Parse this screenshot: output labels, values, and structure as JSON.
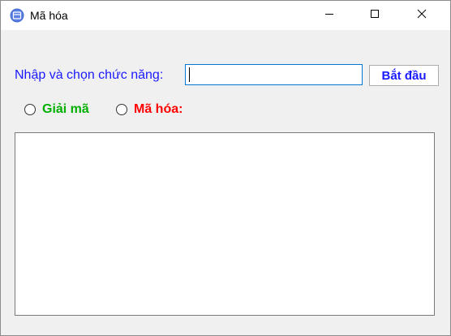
{
  "window": {
    "title": "Mã hóa",
    "icons": {
      "app": "app-window-icon",
      "minimize": "minimize-icon",
      "maximize": "maximize-icon",
      "close": "close-icon"
    }
  },
  "form": {
    "prompt_label": "Nhập và chọn chức năng:",
    "input_value": "",
    "start_button_label": "Bắt đầu"
  },
  "options": {
    "decode_label": "Giải mã",
    "decode_selected": false,
    "encode_label": "Mã hóa:",
    "encode_selected": false
  },
  "output": {
    "text": ""
  },
  "colors": {
    "prompt_text": "#1a1aff",
    "button_text": "#1a1aff",
    "decode_text": "#00b000",
    "encode_text": "#ff0000",
    "input_focus_border": "#0078d7",
    "window_bg": "#f0f0f0"
  }
}
